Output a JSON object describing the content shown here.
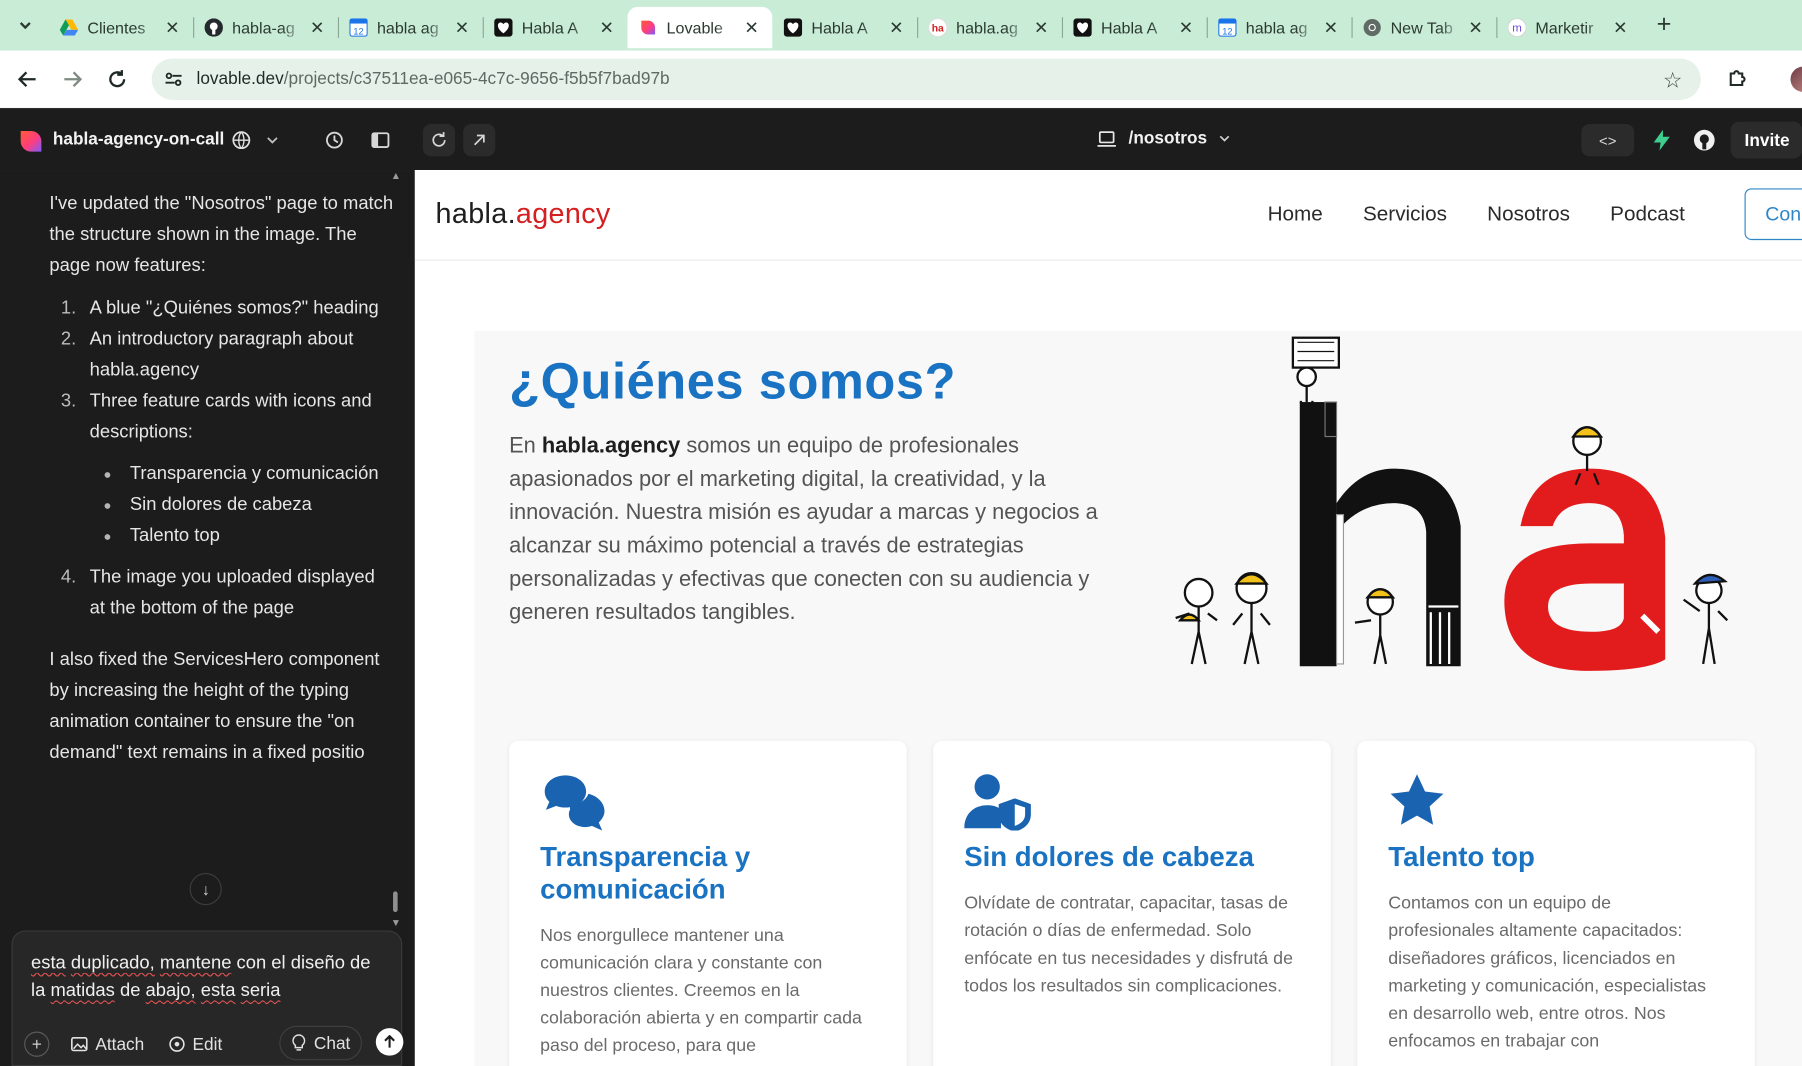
{
  "browser": {
    "tabs": [
      {
        "title": "Clientes",
        "favicon": "google-drive-icon"
      },
      {
        "title": "habla-ag",
        "favicon": "github-icon"
      },
      {
        "title": "habla ag",
        "favicon": "calendar-icon"
      },
      {
        "title": "Habla A",
        "favicon": "heart-icon"
      },
      {
        "title": "Lovable",
        "favicon": "lovable-icon",
        "active": true
      },
      {
        "title": "Habla A",
        "favicon": "heart-icon"
      },
      {
        "title": "habla.ag",
        "favicon": "ha-icon"
      },
      {
        "title": "Habla A",
        "favicon": "heart-icon"
      },
      {
        "title": "habla ag",
        "favicon": "calendar-icon"
      },
      {
        "title": "New Tab",
        "favicon": "chrome-icon"
      },
      {
        "title": "Marketir",
        "favicon": "m-icon"
      }
    ],
    "url_host": "lovable.dev",
    "url_path": "/projects/c37511ea-e065-4c7c-9656-f5b5f7bad97b"
  },
  "lovable": {
    "project_name": "habla-agency-on-call",
    "route": "/nosotros",
    "invite_label": "Invite"
  },
  "chat": {
    "intro": "I've updated the \"Nosotros\" page to match the structure shown in the image. The page now features:",
    "steps": [
      {
        "num": "1.",
        "text": "A blue \"¿Quiénes somos?\" heading"
      },
      {
        "num": "2.",
        "text": "An introductory paragraph about habla.agency"
      },
      {
        "num": "3.",
        "text": "Three feature cards with icons and descriptions:"
      },
      {
        "num": "4.",
        "text": "The image you uploaded displayed at the bottom of the page"
      }
    ],
    "bullets": [
      "Transparencia y comunicación",
      "Sin dolores de cabeza",
      "Talento top"
    ],
    "followup": "I also fixed the ServicesHero component by increasing the height of the typing animation container to ensure the \"on demand\" text remains in a fixed positio",
    "composer_words": [
      "esta",
      "duplicado,",
      "mantene",
      "con",
      "el",
      "diseño",
      "de",
      "la",
      "matidas",
      "de",
      "abajo,",
      "esta",
      "seria"
    ],
    "attach_label": "Attach",
    "edit_label": "Edit",
    "chat_label": "Chat"
  },
  "site": {
    "brand_main": "habla.",
    "brand_accent": "agency",
    "nav": [
      "Home",
      "Servicios",
      "Nosotros",
      "Podcast"
    ],
    "cta_label": "Con",
    "heading": "¿Quiénes somos?",
    "intro_prefix": "En",
    "intro_brand": "habla.agency",
    "intro_rest": "somos un equipo de profesionales apasionados por el marketing digital, la creatividad, y la innovación. Nuestra misión es ayudar a marcas y negocios a alcanzar su máximo potencial a través de estrategias personalizadas y efectivas que conecten con su audiencia y generen resultados tangibles.",
    "cards": [
      {
        "icon": "chat-bubbles-icon",
        "title": "Transparencia y comunicación",
        "text": "Nos enorgullece mantener una comunicación clara y constante con nuestros clientes. Creemos en la colaboración abierta y en compartir cada paso del proceso, para que"
      },
      {
        "icon": "user-shield-icon",
        "title": "Sin dolores de cabeza",
        "text": "Olvídate de contratar, capacitar, tasas de rotación o días de enfermedad. Solo enfócate en tus necesidades y disfrutá de todos los resultados sin complicaciones."
      },
      {
        "icon": "star-icon",
        "title": "Talento top",
        "text": "Contamos con un equipo de profesionales altamente capacitados: diseñadores gráficos, licenciados en marketing y comunicación, especialistas en desarrollo web, entre otros. Nos enfocamos en trabajar con"
      }
    ]
  },
  "colors": {
    "tabstrip": "#c9ecd7",
    "brand_blue": "#1a73c2",
    "brand_red": "#d42020",
    "app_dark": "#1c1c1c"
  }
}
